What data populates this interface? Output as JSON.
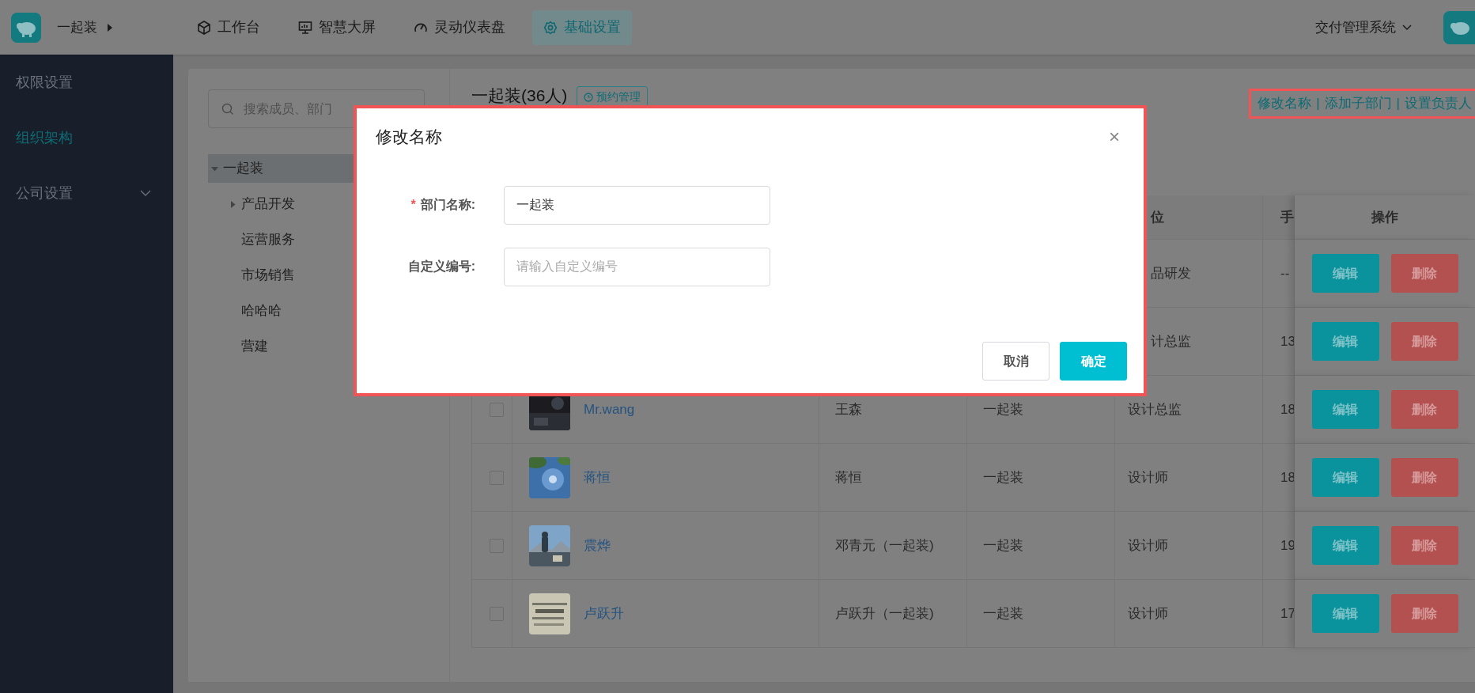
{
  "top_bar": {
    "brand": "一起装",
    "nav": [
      {
        "label": "工作台",
        "selected": false
      },
      {
        "label": "智慧大屏",
        "selected": false
      },
      {
        "label": "灵动仪表盘",
        "selected": false
      },
      {
        "label": "基础设置",
        "selected": true
      }
    ],
    "system": "交付管理系统"
  },
  "sidebar": {
    "items": [
      {
        "label": "权限设置",
        "selected": false
      },
      {
        "label": "组织架构",
        "selected": true
      },
      {
        "label": "公司设置",
        "selected": false,
        "expanded": false
      }
    ]
  },
  "search": {
    "placeholder": "搜索成员、部门"
  },
  "tree": {
    "items": [
      {
        "label": "一起装",
        "selected": true,
        "expanded": true,
        "children": [
          {
            "label": "产品开发",
            "selected": false,
            "expanded": false
          },
          {
            "label": "运营服务",
            "selected": false
          },
          {
            "label": "市场销售",
            "selected": false
          },
          {
            "label": "哈哈哈",
            "selected": false
          },
          {
            "label": "营建",
            "selected": false
          }
        ]
      }
    ]
  },
  "department": {
    "title": "一起装(36人)",
    "button": "预约管理",
    "links": [
      {
        "label": "修改名称",
        "separator": "|"
      },
      {
        "label": "添加子部门",
        "separator": "|"
      },
      {
        "label": "设置负责人"
      }
    ]
  },
  "table": {
    "header": {
      "position": "位",
      "phone": "手",
      "actions": "操作"
    },
    "rows": [
      {
        "position": "品研发",
        "phone": "--",
        "actions": [
          {
            "label": "编辑",
            "kind": "edit"
          },
          {
            "label": "删除",
            "kind": "delete"
          }
        ]
      },
      {
        "position": "计总监",
        "phone": "13",
        "actions": [
          {
            "label": "编辑",
            "kind": "edit"
          },
          {
            "label": "删除",
            "kind": "delete"
          }
        ]
      },
      {
        "checked": false,
        "name": "Mr.wang",
        "nickname": "王森",
        "dept": "一起装",
        "position": "设计总监",
        "phone": "18",
        "actions": [
          {
            "label": "编辑",
            "kind": "edit"
          },
          {
            "label": "删除",
            "kind": "delete"
          }
        ]
      },
      {
        "checked": false,
        "name": "蒋恒",
        "nickname": "蒋恒",
        "dept": "一起装",
        "position": "设计师",
        "phone": "18",
        "actions": [
          {
            "label": "编辑",
            "kind": "edit"
          },
          {
            "label": "删除",
            "kind": "delete"
          }
        ]
      },
      {
        "checked": false,
        "name": "震烨",
        "nickname": "邓青元（一起装)",
        "dept": "一起装",
        "position": "设计师",
        "phone": "19",
        "actions": [
          {
            "label": "编辑",
            "kind": "edit"
          },
          {
            "label": "删除",
            "kind": "delete"
          }
        ]
      },
      {
        "checked": false,
        "name": "卢跃升",
        "nickname": "卢跃升（一起装)",
        "dept": "一起装",
        "position": "设计师",
        "phone": "17",
        "actions": [
          {
            "label": "编辑",
            "kind": "edit"
          },
          {
            "label": "删除",
            "kind": "delete"
          }
        ]
      }
    ]
  },
  "dialog": {
    "title": "修改名称",
    "close": "×",
    "fields": [
      {
        "label": "部门名称:",
        "required_mark": "*",
        "value": "一起装"
      },
      {
        "label": "自定义编号:",
        "placeholder": "请输入自定义编号"
      }
    ],
    "buttons": [
      {
        "label": "取消",
        "kind": "secondary"
      },
      {
        "label": "确定",
        "kind": "primary"
      }
    ]
  }
}
